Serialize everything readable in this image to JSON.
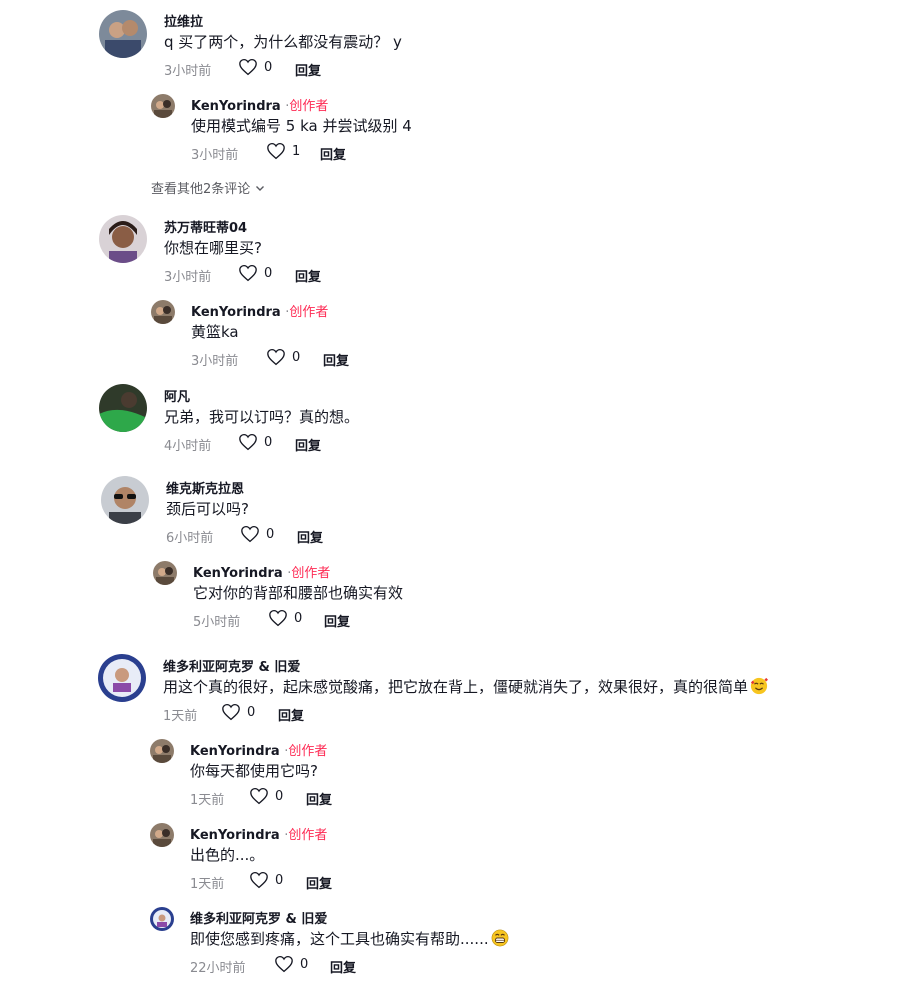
{
  "creator_badge": "创作者",
  "reply_label": "回复",
  "icons": {
    "like": "heart-outline-icon",
    "expand": "chevron-down-icon"
  },
  "colors": {
    "creator": "#fe2c55",
    "meta": "#8a8b91",
    "text": "#161823"
  },
  "comments": [
    {
      "user": "拉维拉",
      "text": "q 买了两个，为什么都没有震动？ y",
      "time": "3小时前",
      "likes": "0"
    },
    {
      "user": "KenYorindra",
      "text": "使用模式编号 5 ka 并尝试级别 4",
      "time": "3小时前",
      "likes": "1"
    },
    {
      "user": "苏万蒂旺蒂04",
      "text": "你想在哪里买?",
      "time": "3小时前",
      "likes": "0"
    },
    {
      "user": "KenYorindra",
      "text": "黄篮ka",
      "time": "3小时前",
      "likes": "0"
    },
    {
      "user": "阿凡",
      "text": "兄弟，我可以订吗？真的想。",
      "time": "4小时前",
      "likes": "0"
    },
    {
      "user": "维克斯克拉恩",
      "text": "颈后可以吗?",
      "time": "6小时前",
      "likes": "0"
    },
    {
      "user": "KenYorindra",
      "text": "它对你的背部和腰部也确实有效",
      "time": "5小时前",
      "likes": "0"
    },
    {
      "user": "维多利亚阿克罗 & 旧爱",
      "text": "用这个真的很好，起床感觉酸痛，把它放在背上，僵硬就消失了，效果很好，真的很简单",
      "time": "1天前",
      "likes": "0"
    },
    {
      "user": "KenYorindra",
      "text": "你每天都使用它吗?",
      "time": "1天前",
      "likes": "0"
    },
    {
      "user": "KenYorindra",
      "text": "出色的...。",
      "time": "1天前",
      "likes": "0"
    },
    {
      "user": "维多利亚阿克罗 & 旧爱",
      "text": "即使您感到疼痛，这个工具也确实有帮助......",
      "time": "22小时前",
      "likes": "0"
    }
  ],
  "view_more": "查看其他2条评论"
}
